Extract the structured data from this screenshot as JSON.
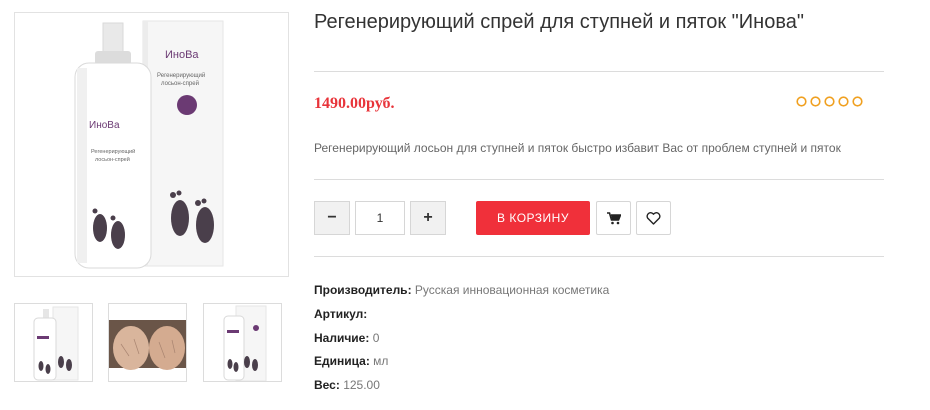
{
  "product": {
    "title": "Регенерирующий спрей для ступней и пяток \"Инова\"",
    "price": "1490.00руб.",
    "rating": 0,
    "rating_max": 5,
    "description": "Регенерирующий лосьон для ступней и пяток быстро избавит Вас от проблем ступней и пяток"
  },
  "packaging": {
    "brand": "ИноВа",
    "line1": "Регенерирующий",
    "line2": "лосьон-спрей"
  },
  "quantity": {
    "minus": "−",
    "value": "1",
    "plus": "+"
  },
  "actions": {
    "add_to_cart": "В КОРЗИНУ"
  },
  "specs": [
    {
      "label": "Производитель:",
      "value": "Русская инновационная косметика"
    },
    {
      "label": "Артикул:",
      "value": ""
    },
    {
      "label": "Наличие:",
      "value": "0"
    },
    {
      "label": "Единица:",
      "value": "мл"
    },
    {
      "label": "Вес:",
      "value": "125.00"
    }
  ],
  "colors": {
    "price": "#e8343a",
    "cart_button": "#f0303a",
    "rating_star": "#f0a020",
    "brand_purple": "#6b3a73"
  },
  "icons": [
    "cart-icon",
    "heart-icon",
    "star-icon"
  ]
}
